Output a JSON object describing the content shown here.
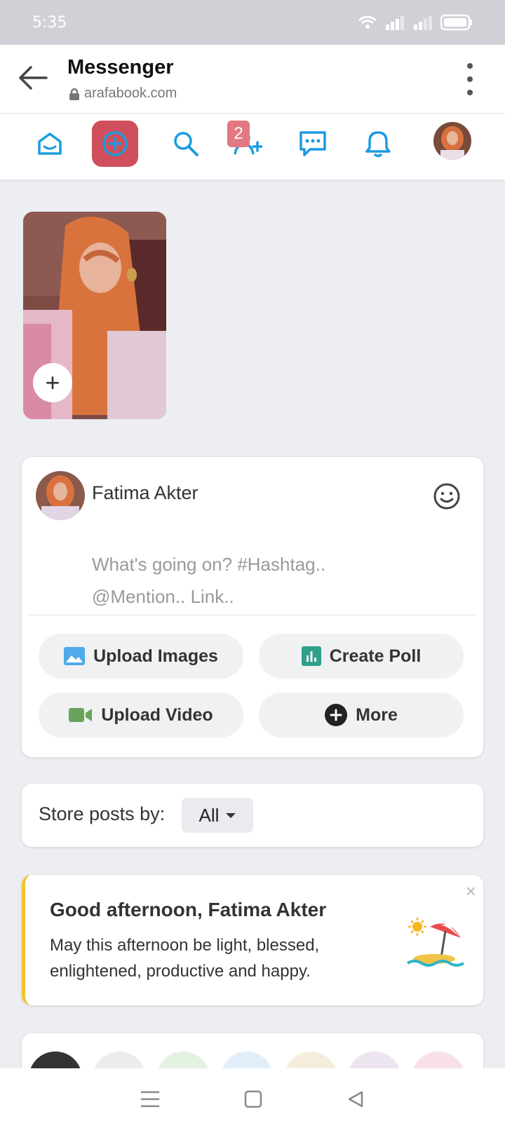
{
  "status": {
    "time": "5:35"
  },
  "browser": {
    "title": "Messenger",
    "url": "arafabook.com"
  },
  "nav": {
    "friend_requests_badge": "2"
  },
  "story": {
    "add_label": "+"
  },
  "composer": {
    "user_name": "Fatima Akter",
    "placeholder_line1": "What's going on? #Hashtag..",
    "placeholder_line2": "@Mention.. Link..",
    "actions": {
      "upload_images": "Upload Images",
      "create_poll": "Create Poll",
      "upload_video": "Upload Video",
      "more": "More"
    }
  },
  "filter": {
    "label": "Store posts by:",
    "selected": "All"
  },
  "greeting": {
    "title": "Good afternoon, Fatima Akter",
    "message": "May this afternoon be light, blessed, enlightened, productive and happy.",
    "close": "×"
  },
  "colors": {
    "accent": "#1b9be0",
    "create_button": "#cf4f5c",
    "badge": "#e27880",
    "greeting_border": "#f2c230"
  }
}
